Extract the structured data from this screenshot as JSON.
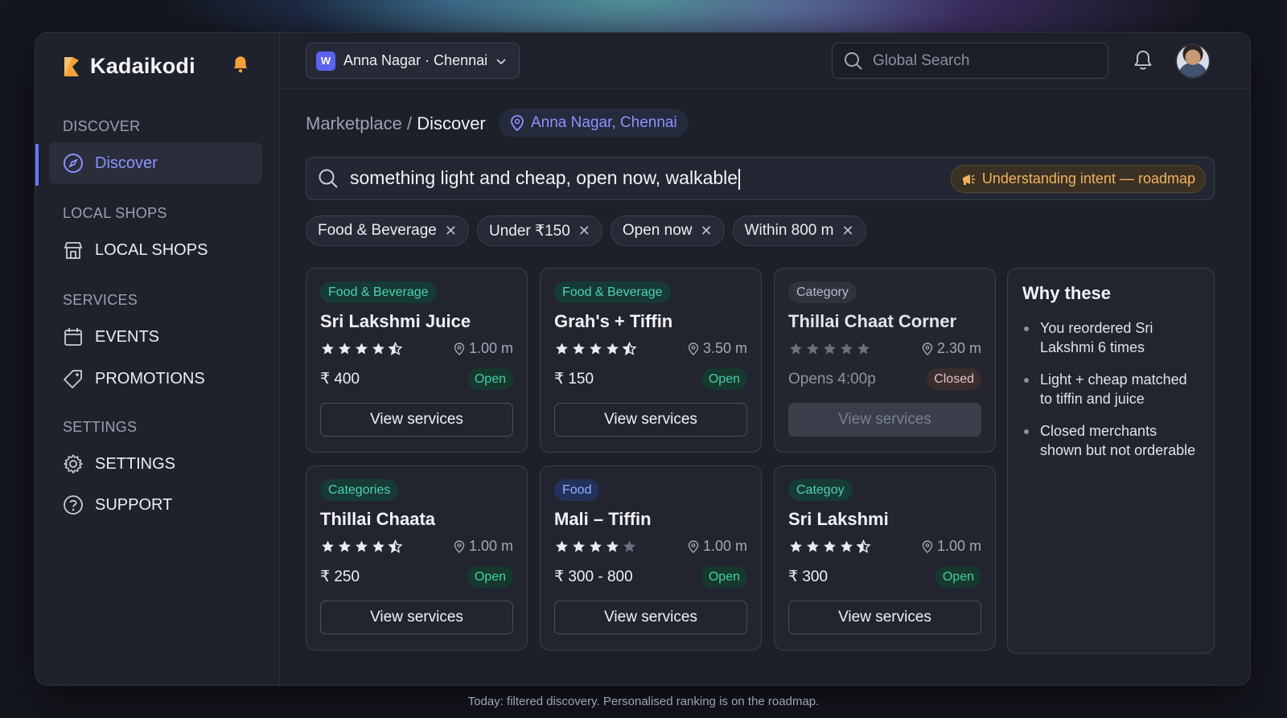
{
  "app": {
    "name": "Kadaikodi",
    "accent": "#6c74ff",
    "brand_color": "#f5a23a"
  },
  "sidebar": {
    "sections": [
      {
        "title": "DISCOVER",
        "items": [
          {
            "label": "Discover",
            "icon": "compass-icon",
            "active": true
          }
        ]
      },
      {
        "title": "LOCAL SHOPS",
        "items": [
          {
            "label": "LOCAL SHOPS",
            "icon": "store-icon"
          }
        ]
      },
      {
        "title": "SERVICES",
        "items": [
          {
            "label": "EVENTS",
            "icon": "calendar-icon"
          },
          {
            "label": "PROMOTIONS",
            "icon": "tag-icon"
          }
        ]
      },
      {
        "title": "SETTINGS",
        "items": [
          {
            "label": "SETTINGS",
            "icon": "gear-icon"
          },
          {
            "label": "SUPPORT",
            "icon": "help-icon"
          }
        ]
      }
    ]
  },
  "topbar": {
    "workspace_badge": "W",
    "location_select": "Anna Nagar · Chennai",
    "search_placeholder": "Global Search"
  },
  "main": {
    "breadcrumb_parent": "Marketplace",
    "breadcrumb_sep": " / ",
    "breadcrumb_current": "Discover",
    "location_pill": "Anna Nagar, Chennai",
    "query": "something light and cheap, open now, walkable",
    "intent_badge": "Understanding intent — roadmap",
    "filters": [
      "Food & Beverage",
      "Under ₹150",
      "Open now",
      "Within 800 m"
    ],
    "cards": [
      {
        "tag": "Food & Beverage",
        "tag_style": "green",
        "name": "Sri Lakshmi Juice",
        "rating": 4.5,
        "distance": "1.00 m",
        "price": "₹ 400",
        "status": "Open",
        "button": "View services",
        "closed": false
      },
      {
        "tag": "Food & Beverage",
        "tag_style": "green",
        "name": "Grah's + Tiffin",
        "rating": 4.5,
        "distance": "3.50 m",
        "price": "₹ 150",
        "status": "Open",
        "button": "View services",
        "closed": false
      },
      {
        "tag": "Category",
        "tag_style": "grey",
        "name": "Thillai Chaat Corner",
        "rating": 5,
        "distance": "2.30 m",
        "price": "Opens 4:00p",
        "status": "Closed",
        "button": "View services",
        "closed": true
      },
      {
        "tag": "Categories",
        "tag_style": "green",
        "name": "Thillai Chaata",
        "rating": 4.5,
        "distance": "1.00 m",
        "price": "₹ 250",
        "status": "Open",
        "button": "View services",
        "closed": false
      },
      {
        "tag": "Food",
        "tag_style": "blue",
        "name": "Mali – Tiffin",
        "rating": 4,
        "distance": "1.00 m",
        "price": "₹ 300 - 800",
        "status": "Open",
        "button": "View services",
        "closed": false
      },
      {
        "tag": "Categoy",
        "tag_style": "green",
        "name": "Sri Lakshmi",
        "rating": 4.5,
        "distance": "1.00 m",
        "price": "₹ 300",
        "status": "Open",
        "button": "View services",
        "closed": false
      }
    ],
    "why": {
      "title": "Why these",
      "reasons": [
        "You reordered Sri Lakshmi 6 times",
        "Light + cheap matched to tiffin and juice",
        "Closed merchants shown but not orderable"
      ]
    }
  },
  "footer_note": "Today: filtered discovery. Personalised ranking is on the roadmap."
}
